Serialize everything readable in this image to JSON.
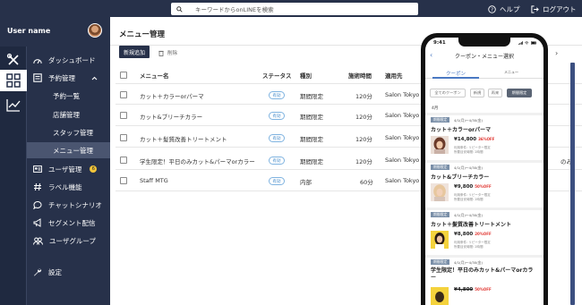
{
  "header": {
    "search_placeholder": "キーワードからonLINEを検索",
    "help_label": "ヘルプ",
    "logout_label": "ログアウト",
    "bg_color": "#27314a"
  },
  "sidebar": {
    "username": "User name",
    "items": [
      {
        "label": "ダッシュボード",
        "icon": "speedometer-icon"
      },
      {
        "label": "予約管理",
        "icon": "calendar-list-icon"
      },
      {
        "label": "予約一覧"
      },
      {
        "label": "店舗管理"
      },
      {
        "label": "スタッフ管理"
      },
      {
        "label": "メニュー管理"
      },
      {
        "label": "ユーザ管理",
        "icon": "user-card-icon",
        "badge": "6"
      },
      {
        "label": "ラベル機能",
        "icon": "hash-icon"
      },
      {
        "label": "チャットシナリオ",
        "icon": "chat-icon"
      },
      {
        "label": "セグメント配信",
        "icon": "megaphone-icon"
      },
      {
        "label": "ユーザグループ",
        "icon": "users-icon"
      },
      {
        "label": "設定",
        "icon": "wrench-icon"
      }
    ]
  },
  "main": {
    "title": "メニュー管理",
    "new_button": "新規追加",
    "delete_button": "削除",
    "columns": [
      "メニュー名",
      "ステータス",
      "種別",
      "施術時間",
      "適用先"
    ],
    "rows": [
      {
        "name": "カット＋カラーorパーマ",
        "status": "有効",
        "type": "期間限定",
        "time": "120分",
        "target": "Salon Tokyo"
      },
      {
        "name": "カット&ブリーチカラー",
        "status": "有効",
        "type": "期間限定",
        "time": "120分",
        "target": "Salon Tokyo"
      },
      {
        "name": "カット＋髪質改善トリートメント",
        "status": "有効",
        "type": "期間限定",
        "time": "120分",
        "target": "Salon Tokyo"
      },
      {
        "name": "学生限定！平日のみカット&パーマorカラー",
        "status": "有効",
        "type": "期間限定",
        "time": "120分",
        "target": "Salon Tokyo",
        "extra": "のみ"
      },
      {
        "name": "Staff MTG",
        "status": "有効",
        "type": "内部",
        "time": "60分",
        "target": "Salon Tokyo"
      }
    ]
  },
  "phone": {
    "time": "9:41",
    "title": "クーポン・メニュー選択",
    "tabs": [
      "クーポン",
      "メニュー"
    ],
    "chips": [
      "全てのクーポン",
      "新規",
      "再来",
      "期間限定"
    ],
    "month": "4月",
    "cards": [
      {
        "tag": "期間限定",
        "period": "4/1(月)〜4/30(金)",
        "title": "カット＋カラーorパーマ",
        "price": "¥14,800",
        "off": "36%OFF",
        "note1": "利用条件: リピーター限定",
        "note2": "所要目安時間: 2時間"
      },
      {
        "tag": "期間限定",
        "period": "4/1(月)〜4/30(金)",
        "title": "カット&ブリーチカラー",
        "price": "¥9,800",
        "off": "50%OFF",
        "note1": "利用条件: リピーター限定",
        "note2": "所要目安時間: 2時間"
      },
      {
        "tag": "期間限定",
        "period": "4/1(月)〜4/30(金)",
        "title": "カット＋髪質改善トリートメント",
        "price": "¥8,800",
        "off": "20%OFF",
        "note1": "利用条件: リピーター限定",
        "note2": "所要目安時間: 2時間"
      },
      {
        "tag": "期間限定",
        "period": "4/1(月)〜4/30(金)",
        "title": "学生限定！平日のみカット&パーマorカラー",
        "price": "¥4,800",
        "off": "50%OFF"
      }
    ]
  }
}
